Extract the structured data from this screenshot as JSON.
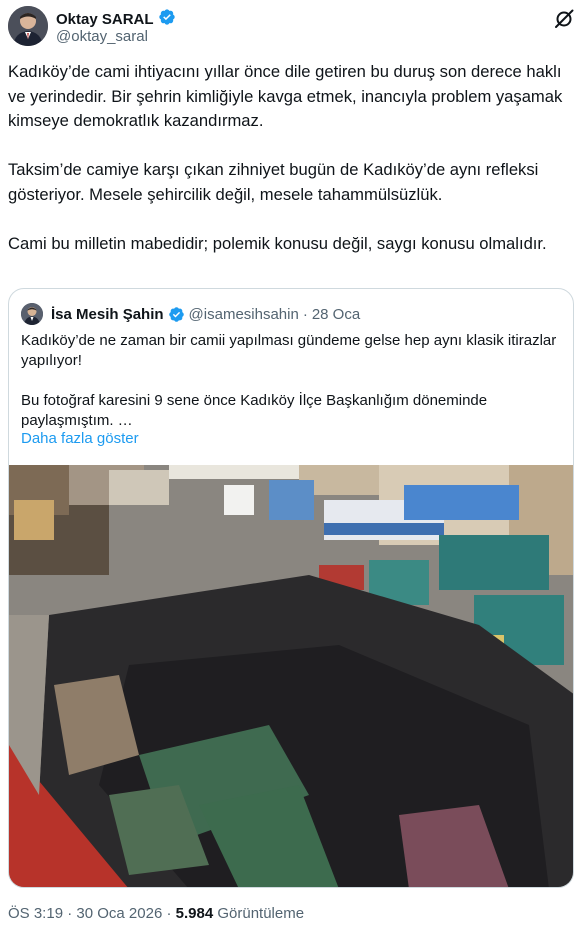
{
  "author": {
    "name": "Oktay SARAL",
    "handle": "@oktay_saral",
    "verified_icon": "verified-badge-icon"
  },
  "post": {
    "paragraphs": [
      "Kadıköy’de cami ihtiyacını yıllar önce dile getiren bu duruş son derece haklı ve yerindedir. Bir şehrin kimliğiyle kavga etmek, inancıyla problem yaşamak kimseye demokratlık kazandırmaz.",
      "Taksim’de camiye karşı çıkan zihniyet bugün de Kadıköy’de aynı refleksi gösteriyor. Mesele şehircilik değil, mesele tahammülsüzlük.",
      "Cami bu milletin mabedidir; polemik konusu değil, saygı konusu olmalıdır."
    ]
  },
  "quote": {
    "name": "İsa Mesih Şahin",
    "handle": "@isamesihsahin",
    "separator": "·",
    "date": "28 Oca",
    "paragraph1": "Kadıköy’de ne zaman bir camii yapılması gündeme gelse hep aynı klasik itirazlar yapılıyor!",
    "paragraph2": "Bu fotoğraf karesini 9 sene önce Kadıköy İlçe Başkanlığım döneminde paylaşmıştım. …",
    "show_more": "Daha fazla göster"
  },
  "footer": {
    "time": "ÖS 3:19",
    "sep1": "·",
    "date": "30 Oca 2026",
    "sep2": "·",
    "views_count": "5.984",
    "views_label": "Görüntüleme"
  },
  "colors": {
    "accent": "#1d9bf0",
    "text": "#0f1419",
    "muted": "#536471",
    "border": "#cfd9de"
  }
}
